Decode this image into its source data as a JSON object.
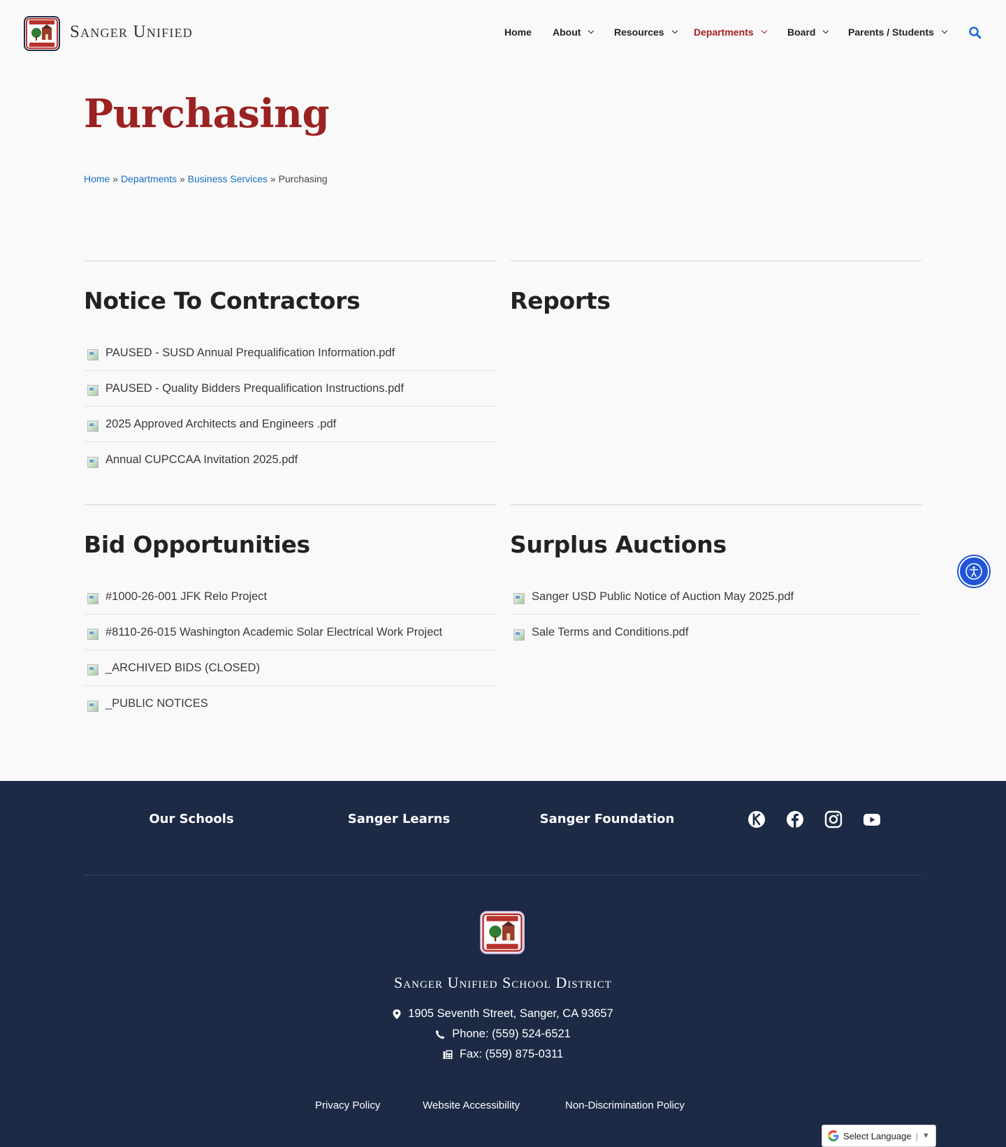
{
  "site": {
    "title": "Sanger Unified"
  },
  "nav": {
    "items": [
      {
        "label": "Home",
        "dropdown": false,
        "active": false
      },
      {
        "label": "About",
        "dropdown": true,
        "active": false
      },
      {
        "label": "Resources",
        "dropdown": true,
        "active": false
      },
      {
        "label": "Departments",
        "dropdown": true,
        "active": true
      },
      {
        "label": "Board",
        "dropdown": true,
        "active": false
      },
      {
        "label": "Parents / Students",
        "dropdown": true,
        "active": false
      }
    ]
  },
  "page": {
    "title": "Purchasing"
  },
  "breadcrumb": {
    "links": [
      "Home",
      "Departments",
      "Business Services"
    ],
    "separator": "»",
    "current": "Purchasing"
  },
  "sections": {
    "notice": {
      "title": "Notice To Contractors",
      "files": [
        "PAUSED - SUSD Annual Prequalification Information.pdf",
        "PAUSED - Quality Bidders Prequalification Instructions.pdf",
        "2025 Approved Architects and Engineers .pdf",
        "Annual CUPCCAA Invitation 2025.pdf"
      ]
    },
    "reports": {
      "title": "Reports",
      "files": []
    },
    "bids": {
      "title": "Bid Opportunities",
      "files": [
        "#1000-26-001 JFK Relo Project",
        "#8110-26-015 Washington Academic Solar Electrical Work Project",
        "_ARCHIVED BIDS (CLOSED)",
        "_PUBLIC NOTICES"
      ]
    },
    "surplus": {
      "title": "Surplus Auctions",
      "files": [
        "Sanger USD Public Notice of Auction May 2025.pdf",
        "Sale Terms and Conditions.pdf"
      ]
    }
  },
  "footer": {
    "links": [
      "Our Schools",
      "Sanger Learns",
      "Sanger Foundation"
    ],
    "social_icons": [
      "rooms-icon",
      "facebook-icon",
      "instagram-icon",
      "youtube-icon"
    ],
    "district_name": "Sanger Unified School District",
    "address": "1905 Seventh Street, Sanger, CA 93657",
    "phone": "Phone: (559) 524-6521",
    "fax": "Fax: (559) 875-0311",
    "legal": [
      "Privacy Policy",
      "Website Accessibility",
      "Non-Discrimination Policy"
    ],
    "language": {
      "label": "Select Language",
      "arrow": "▼"
    }
  },
  "colors": {
    "accent": "#a31f1f",
    "link": "#1a6fc9",
    "footer_bg": "#1c2a46",
    "a11y_button": "#1f55d6"
  }
}
